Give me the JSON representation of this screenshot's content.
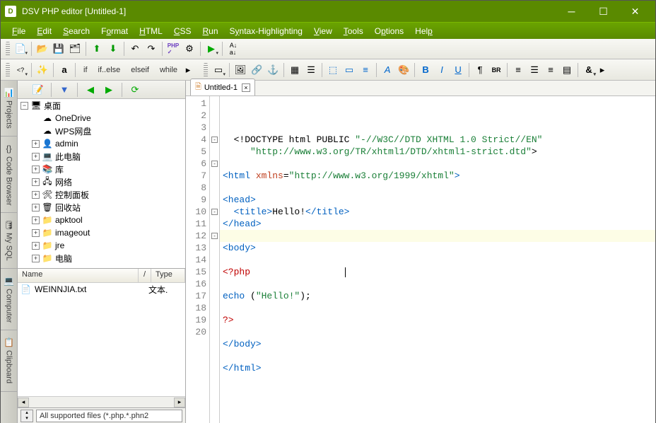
{
  "titlebar": {
    "title": "DSV PHP editor [Untitled-1]"
  },
  "menu": [
    "File",
    "Edit",
    "Search",
    "Format",
    "HTML",
    "CSS",
    "Run",
    "Syntax-Highlighting",
    "View",
    "Tools",
    "Options",
    "Help"
  ],
  "toolbar2": {
    "btns": [
      "if",
      "if..else",
      "elseif",
      "while"
    ]
  },
  "side_tabs": [
    "Projects",
    "Code Browser",
    "My SQL",
    "Computer",
    "Clipboard"
  ],
  "tree": {
    "root": "桌面",
    "items": [
      {
        "label": "OneDrive",
        "icon": "☁",
        "exp": ""
      },
      {
        "label": "WPS网盘",
        "icon": "☁",
        "exp": ""
      },
      {
        "label": "admin",
        "icon": "👤",
        "exp": "+"
      },
      {
        "label": "此电脑",
        "icon": "💻",
        "exp": "+"
      },
      {
        "label": "库",
        "icon": "📚",
        "exp": "+"
      },
      {
        "label": "网络",
        "icon": "🖧",
        "exp": "+"
      },
      {
        "label": "控制面板",
        "icon": "🛠",
        "exp": "+"
      },
      {
        "label": "回收站",
        "icon": "🗑",
        "exp": "+"
      },
      {
        "label": "apktool",
        "icon": "📁",
        "exp": "+"
      },
      {
        "label": "imageout",
        "icon": "📁",
        "exp": "+"
      },
      {
        "label": "jre",
        "icon": "📁",
        "exp": "+"
      },
      {
        "label": "电脑",
        "icon": "📁",
        "exp": "+"
      }
    ]
  },
  "filelist": {
    "cols": {
      "name": "Name",
      "type": "Type",
      "slash": "/"
    },
    "rows": [
      {
        "name": "WEINNJIA.txt",
        "type": "文本."
      }
    ]
  },
  "filter": "All supported files (*.php.*.phn2",
  "editor": {
    "tab": "Untitled-1",
    "lines": [
      {
        "n": 1,
        "fold": "",
        "html": "  &lt;!DOCTYPE html PUBLIC <span class='str'>\"-//W3C//DTD XHTML 1.0 Strict//EN\"</span>"
      },
      {
        "n": 2,
        "fold": "",
        "html": "     <span class='str'>\"http://www.w3.org/TR/xhtml1/DTD/xhtml1-strict.dtd\"</span>&gt;"
      },
      {
        "n": 3,
        "fold": "",
        "html": ""
      },
      {
        "n": 4,
        "fold": "-",
        "html": "<span class='tag'>&lt;html</span> <span class='attr'>xmlns</span>=<span class='str'>\"http://www.w3.org/1999/xhtml\"</span><span class='tag'>&gt;</span>"
      },
      {
        "n": 5,
        "fold": "",
        "html": ""
      },
      {
        "n": 6,
        "fold": "-",
        "html": "<span class='tag'>&lt;head&gt;</span>"
      },
      {
        "n": 7,
        "fold": "",
        "html": "  <span class='tag'>&lt;title&gt;</span>Hello!<span class='tag'>&lt;/title&gt;</span>"
      },
      {
        "n": 8,
        "fold": "",
        "html": "<span class='tag'>&lt;/head&gt;</span>"
      },
      {
        "n": 9,
        "fold": "",
        "html": ""
      },
      {
        "n": 10,
        "fold": "-",
        "html": "<span class='tag'>&lt;body&gt;</span>"
      },
      {
        "n": 11,
        "fold": "",
        "html": ""
      },
      {
        "n": 12,
        "fold": "-",
        "html": "<span class='red'>&lt;?php</span>                 <span class='caret'></span>"
      },
      {
        "n": 13,
        "fold": "",
        "html": ""
      },
      {
        "n": 14,
        "fold": "",
        "html": "<span class='kw'>echo</span> (<span class='str'>\"Hello!\"</span>);"
      },
      {
        "n": 15,
        "fold": "",
        "html": ""
      },
      {
        "n": 16,
        "fold": "",
        "html": "<span class='red'>?&gt;</span>"
      },
      {
        "n": 17,
        "fold": "",
        "html": ""
      },
      {
        "n": 18,
        "fold": "",
        "html": "<span class='tag'>&lt;/body&gt;</span>"
      },
      {
        "n": 19,
        "fold": "",
        "html": ""
      },
      {
        "n": 20,
        "fold": "",
        "html": "<span class='tag'>&lt;/html&gt;</span>"
      }
    ]
  }
}
